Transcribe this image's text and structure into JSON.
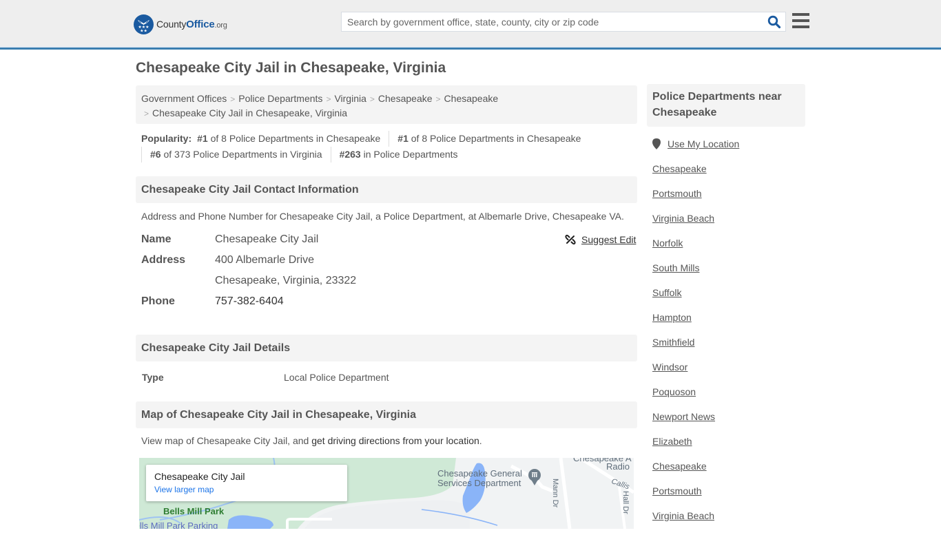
{
  "header": {
    "logo": {
      "part1": "County",
      "part2": "Office",
      "part3": ".org"
    },
    "search_placeholder": "Search by government office, state, county, city or zip code",
    "search_icon": "search-icon",
    "menu_icon": "hamburger-menu-icon",
    "accent_color": "#3a7eb0",
    "brand_color": "#1a5aa0"
  },
  "page_title": "Chesapeake City Jail in Chesapeake, Virginia",
  "breadcrumb": [
    "Government Offices",
    "Police Departments",
    "Virginia",
    "Chesapeake",
    "Chesapeake",
    "Chesapeake City Jail in Chesapeake, Virginia"
  ],
  "popularity": {
    "label": "Popularity:",
    "items": [
      {
        "rank": "#1",
        "text": " of 8 Police Departments in Chesapeake"
      },
      {
        "rank": "#1",
        "text": " of 8 Police Departments in Chesapeake"
      },
      {
        "rank": "#6",
        "text": " of 373 Police Departments in Virginia"
      },
      {
        "rank": "#263",
        "text": " in Police Departments"
      }
    ]
  },
  "contact": {
    "heading": "Chesapeake City Jail Contact Information",
    "description": "Address and Phone Number for Chesapeake City Jail, a Police Department, at Albemarle Drive, Chesapeake VA.",
    "suggest_edit": "Suggest Edit",
    "name_label": "Name",
    "name_value": "Chesapeake City Jail",
    "address_label": "Address",
    "address_line1": "400 Albemarle Drive",
    "address_line2": "Chesapeake, Virginia, 23322",
    "phone_label": "Phone",
    "phone_value": "757-382-6404"
  },
  "details": {
    "heading": "Chesapeake City Jail Details",
    "type_label": "Type",
    "type_value": "Local Police Department"
  },
  "map": {
    "heading": "Map of Chesapeake City Jail in Chesapeake, Virginia",
    "desc_prefix": "View map of Chesapeake City Jail, and ",
    "desc_link": "get driving directions from your location",
    "desc_suffix": ".",
    "card_title": "Chesapeake City Jail",
    "card_link": "View larger map",
    "labels": {
      "general_services_1": "Chesapeake General",
      "general_services_2": "Services Department",
      "bells_mill_park": "Bells Mill Park",
      "bells_mill_parking": "Bells Mill Park Parking",
      "radio_1": "Chesapeake A",
      "radio_2": "Radio",
      "mann_dr": "Mann Dr",
      "hall_dr": "Hall Dr",
      "callis": "Callis"
    }
  },
  "sidebar": {
    "heading": "Police Departments near Chesapeake",
    "use_location": "Use My Location",
    "items": [
      "Chesapeake",
      "Portsmouth",
      "Virginia Beach",
      "Norfolk",
      "South Mills",
      "Suffolk",
      "Hampton",
      "Smithfield",
      "Windsor",
      "Poquoson",
      "Newport News",
      "Elizabeth",
      "Chesapeake",
      "Portsmouth",
      "Virginia Beach"
    ]
  }
}
